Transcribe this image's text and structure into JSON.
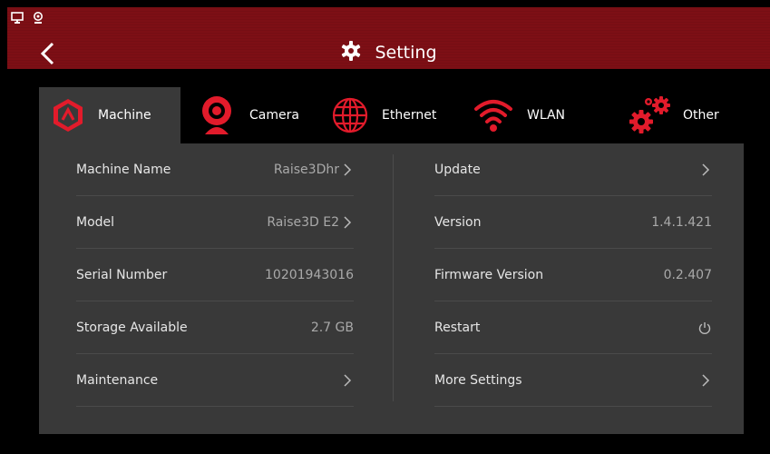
{
  "header": {
    "title": "Setting"
  },
  "tabs": [
    {
      "label": "Machine",
      "icon": "machine-icon",
      "active": true
    },
    {
      "label": "Camera",
      "icon": "camera-icon",
      "active": false
    },
    {
      "label": "Ethernet",
      "icon": "globe-icon",
      "active": false
    },
    {
      "label": "WLAN",
      "icon": "wifi-icon",
      "active": false
    },
    {
      "label": "Other",
      "icon": "gears-icon",
      "active": false
    }
  ],
  "left_rows": [
    {
      "label": "Machine Name",
      "value": "Raise3Dhr",
      "action": "chevron"
    },
    {
      "label": "Model",
      "value": "Raise3D E2",
      "action": "chevron"
    },
    {
      "label": "Serial Number",
      "value": "10201943016",
      "action": ""
    },
    {
      "label": "Storage Available",
      "value": "2.7 GB",
      "action": ""
    },
    {
      "label": "Maintenance",
      "value": "",
      "action": "chevron"
    }
  ],
  "right_rows": [
    {
      "label": "Update",
      "value": "",
      "action": "chevron"
    },
    {
      "label": "Version",
      "value": "1.4.1.421",
      "action": ""
    },
    {
      "label": "Firmware Version",
      "value": "0.2.407",
      "action": ""
    },
    {
      "label": "Restart",
      "value": "",
      "action": "power"
    },
    {
      "label": "More Settings",
      "value": "",
      "action": "chevron"
    }
  ],
  "colors": {
    "accent": "#e21b2b",
    "header_bg": "#7d0f15",
    "panel_bg": "#393939",
    "page_bg": "#000000"
  }
}
